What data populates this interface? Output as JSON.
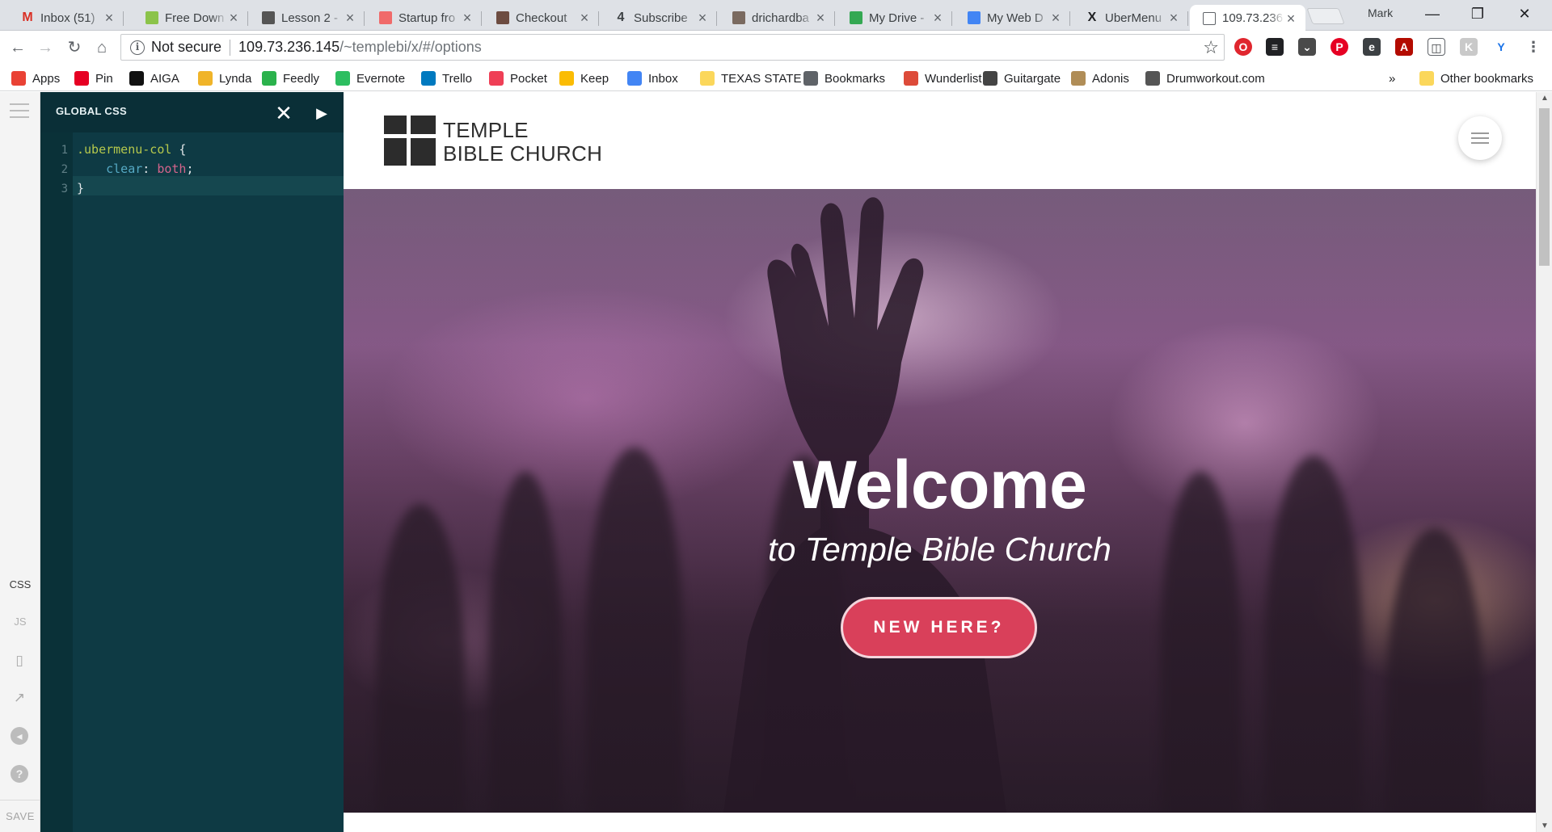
{
  "browser": {
    "tabs": [
      {
        "title": "Inbox (51)",
        "icon": "gmail-icon",
        "color": "#d93025",
        "glyph": "M"
      },
      {
        "title": "Free Down",
        "icon": "leaf-icon",
        "color": "#8bc34a",
        "glyph": ""
      },
      {
        "title": "Lesson 2 -",
        "icon": "lesson-icon",
        "color": "#555555",
        "glyph": ""
      },
      {
        "title": "Startup fro",
        "icon": "asana-icon",
        "color": "#f06a6a",
        "glyph": ""
      },
      {
        "title": "Checkout",
        "icon": "checkout-icon",
        "color": "#6d4c41",
        "glyph": ""
      },
      {
        "title": "Subscribe",
        "icon": "number-four-icon",
        "color": "#3c4043",
        "glyph": "4"
      },
      {
        "title": "drichardba",
        "icon": "photo-icon",
        "color": "#7a6a60",
        "glyph": ""
      },
      {
        "title": "My Drive -",
        "icon": "google-drive-icon",
        "color": "#34a853",
        "glyph": ""
      },
      {
        "title": "My Web D",
        "icon": "google-docs-icon",
        "color": "#4285f4",
        "glyph": ""
      },
      {
        "title": "UberMenu",
        "icon": "x-logo-icon",
        "color": "#202124",
        "glyph": "X"
      },
      {
        "title": "109.73.236",
        "icon": "page-icon",
        "color": "#ffffff",
        "glyph": ""
      }
    ],
    "profile_name": "Mark",
    "address": {
      "security_label": "Not secure",
      "host": "109.73.236.145",
      "path": "/~templebi/x/#/options"
    },
    "bookmarks": [
      {
        "label": "Apps",
        "icon": "apps-grid-icon",
        "color": "#e94235"
      },
      {
        "label": "Pin",
        "icon": "pinterest-icon",
        "color": "#e60023"
      },
      {
        "label": "AIGA",
        "icon": "aiga-icon",
        "color": "#111111"
      },
      {
        "label": "Lynda",
        "icon": "lynda-icon",
        "color": "#f0b429"
      },
      {
        "label": "Feedly",
        "icon": "feedly-icon",
        "color": "#2bb24c"
      },
      {
        "label": "Evernote",
        "icon": "evernote-icon",
        "color": "#2dbe60"
      },
      {
        "label": "Trello",
        "icon": "trello-icon",
        "color": "#0079bf"
      },
      {
        "label": "Pocket",
        "icon": "pocket-icon",
        "color": "#ef3f56"
      },
      {
        "label": "Keep",
        "icon": "keep-icon",
        "color": "#fbbc04"
      },
      {
        "label": "Inbox",
        "icon": "inbox-icon",
        "color": "#4285f4"
      },
      {
        "label": "TEXAS STATE",
        "icon": "folder-icon",
        "color": "#fbd75b"
      },
      {
        "label": "Bookmarks",
        "icon": "star-icon",
        "color": "#5f6368"
      },
      {
        "label": "Wunderlist",
        "icon": "wunderlist-icon",
        "color": "#dd4b39"
      },
      {
        "label": "Guitargate",
        "icon": "guitargate-icon",
        "color": "#444444"
      },
      {
        "label": "Adonis",
        "icon": "adonis-icon",
        "color": "#b08d57"
      },
      {
        "label": "Drumworkout.com",
        "icon": "drumworkout-icon",
        "color": "#555555"
      }
    ],
    "overflow_label": "»",
    "other_bookmarks": "Other bookmarks"
  },
  "editor": {
    "title": "GLOBAL CSS",
    "line_numbers": [
      "1",
      "2",
      "3"
    ],
    "code": {
      "selector": ".ubermenu-col",
      "open_brace": " {",
      "indent": "    ",
      "property": "clear",
      "colon": ": ",
      "value": "both",
      "semicolon": ";",
      "close_brace": "}"
    },
    "rail": {
      "css_label": "CSS",
      "js_label": "JS",
      "save_label": "SAVE"
    }
  },
  "site": {
    "logo_line1": "TEMPLE",
    "logo_line2": "BIBLE CHURCH",
    "hero_title": "Welcome",
    "hero_subtitle": "to Temple Bible Church",
    "cta_label": "NEW HERE?",
    "cta_color": "#d9405a",
    "overlay_color": "#2e1f2e"
  }
}
